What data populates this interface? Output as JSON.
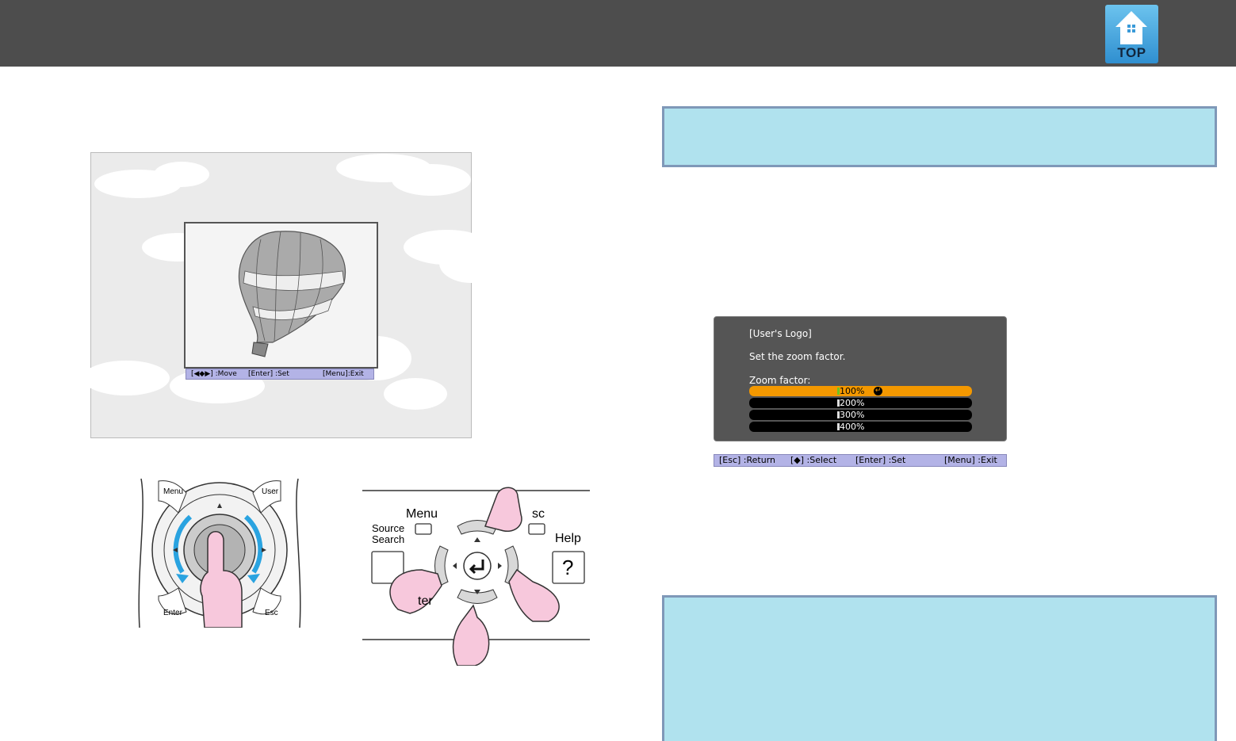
{
  "header": {
    "top_button_label": "TOP"
  },
  "balloon_screen": {
    "status_move": "[◀◆▶] :Move",
    "status_set": "[Enter] :Set",
    "status_exit": "[Menu]:Exit"
  },
  "remote": {
    "menu_label": "Menu",
    "user_label": "User",
    "enter_label": "Enter",
    "esc_label": "Esc"
  },
  "panel": {
    "menu_label": "Menu",
    "source_label_1": "Source",
    "source_label_2": "Search",
    "help_label": "Help",
    "help_symbol": "?",
    "esc_label": "sc",
    "enter_label": "ter"
  },
  "logo_menu": {
    "title": "[User's Logo]",
    "instruction": "Set the zoom factor.",
    "zoom_label": "Zoom factor:",
    "options": [
      "100%",
      "200%",
      "300%",
      "400%"
    ],
    "selected_index": 0,
    "statusbar": {
      "return": "[Esc] :Return",
      "select": "[◆] :Select",
      "set": "[Enter] :Set",
      "exit": "[Menu] :Exit"
    }
  },
  "colors": {
    "header_bg": "#4d4d4d",
    "note_bg": "#b0e2ee",
    "note_border": "#7f98b8",
    "selected_option": "#f39800",
    "status_bar": "#b3b3e6"
  }
}
